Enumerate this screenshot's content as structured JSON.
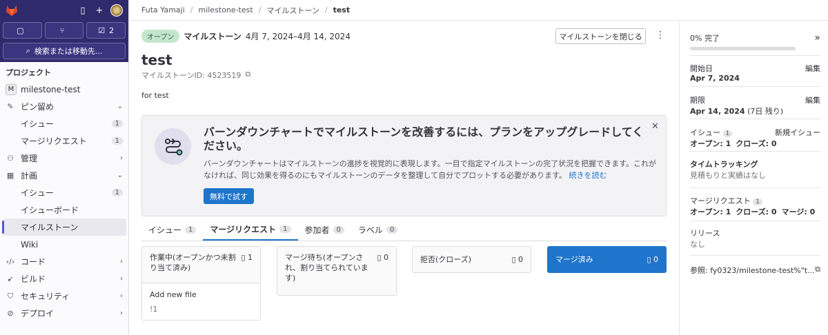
{
  "sidebar": {
    "counts": {
      "issues": "",
      "merge_requests": "",
      "todos": "2"
    },
    "search_label": "検索または移動先...",
    "section_label": "プロジェクト",
    "project_initial": "M",
    "project_name": "milestone-test",
    "pinned": {
      "label": "ピン留め",
      "issues": "イシュー",
      "issues_count": "1",
      "mrs": "マージリクエスト",
      "mrs_count": "1"
    },
    "manage": "管理",
    "plan": {
      "label": "計画",
      "issues": "イシュー",
      "issues_count": "1",
      "boards": "イシューボード",
      "milestones": "マイルストーン",
      "wiki": "Wiki"
    },
    "code": "コード",
    "build": "ビルド",
    "security": "セキュリティ",
    "deploy": "デプロイ"
  },
  "breadcrumb": {
    "user": "Futa Yamaji",
    "project": "milestone-test",
    "section": "マイルストーン",
    "current": "test"
  },
  "milestone": {
    "status": "オープン",
    "label": "マイルストーン",
    "dates": "4月 7, 2024–4月 14, 2024",
    "close_button": "マイルストーンを閉じる",
    "title": "test",
    "id_text": "マイルストーンID: 4523519",
    "description": "for test"
  },
  "promo": {
    "title": "バーンダウンチャートでマイルストーンを改善するには、プランをアップグレードしてください。",
    "body": "バーンダウンチャートはマイルストーンの進捗を視覚的に表現します。一目で指定マイルストーンの完了状況を把握できます。これがなければ、同じ効果を得るのにもマイルストーンのデータを整理して自分でプロットする必要があります。",
    "link": "続きを読む",
    "button": "無料で試す"
  },
  "tabs": [
    {
      "label": "イシュー",
      "count": "1"
    },
    {
      "label": "マージリクエスト",
      "count": "1"
    },
    {
      "label": "参加者",
      "count": "0"
    },
    {
      "label": "ラベル",
      "count": "0"
    }
  ],
  "columns": [
    {
      "title": "作業中(オープンかつ未割り当て済み)",
      "count": "1",
      "item_title": "Add new file",
      "item_ref": "!1"
    },
    {
      "title": "マージ待ち(オープンされ、割り当てられています)",
      "count": "0"
    },
    {
      "title": "拒否(クローズ)",
      "count": "0"
    },
    {
      "title": "マージ済み",
      "count": "0"
    }
  ],
  "right": {
    "complete": "0% 完了",
    "start_label": "開始日",
    "start_date": "Apr 7, 2024",
    "edit": "編集",
    "due_label": "期限",
    "due_date": "Apr 14, 2024",
    "due_remaining": "(7日 残り)",
    "issues_label": "イシュー",
    "issues_count": "1",
    "new_issue": "新規イシュー",
    "issues_open": "オープン: 1",
    "issues_closed": "クローズ: 0",
    "time_label": "タイムトラッキング",
    "time_value": "見積もりと実績はなし",
    "mr_label": "マージリクエスト",
    "mr_count": "1",
    "mr_open": "オープン: 1",
    "mr_closed": "クローズ: 0",
    "mr_merged": "マージ: 0",
    "release_label": "リリース",
    "release_value": "なし",
    "reference": "参照: fy0323/milestone-test%\"t..."
  }
}
